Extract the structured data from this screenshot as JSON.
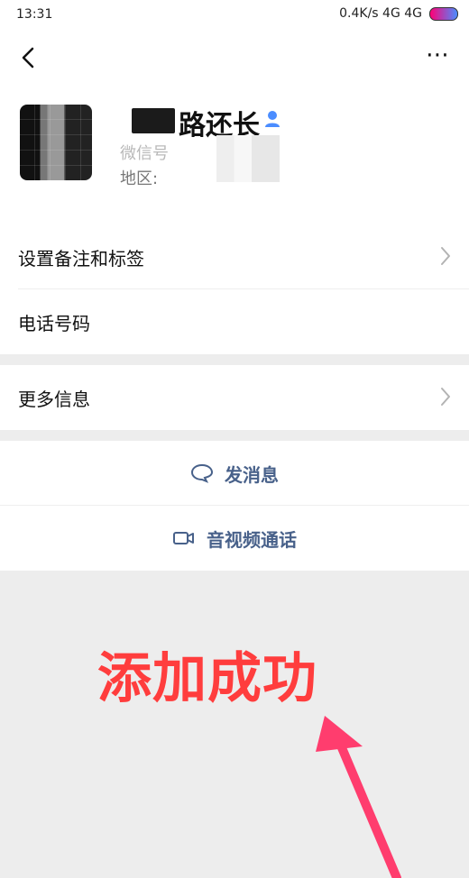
{
  "status_bar": {
    "time": "13:31",
    "right": "0.4K/s  4G  4G"
  },
  "appbar": {
    "more": "⋯"
  },
  "profile": {
    "name": "路还长",
    "wechat_label": "微信号",
    "region_label": "地区:"
  },
  "rows": {
    "remark": "设置备注和标签",
    "phone": "电话号码",
    "more_info": "更多信息"
  },
  "actions": {
    "message": "发消息",
    "call": "音视频通话"
  },
  "overlay_text": "添加成功",
  "colors": {
    "accent": "#48618a",
    "overlay": "#ff3d3d",
    "background": "#ededed"
  }
}
